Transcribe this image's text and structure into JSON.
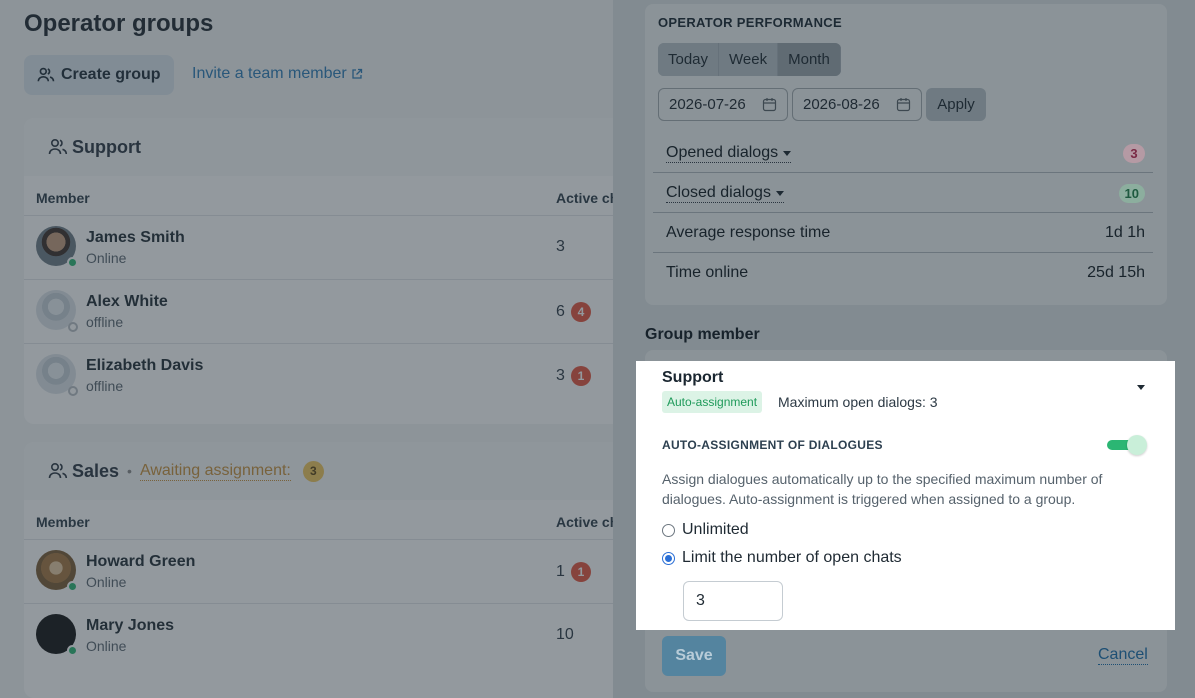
{
  "page": {
    "title": "Operator groups",
    "create_group": "Create group",
    "invite": "Invite a team member"
  },
  "groups": [
    {
      "name": "Support",
      "columns": {
        "member": "Member",
        "active": "Active ch"
      },
      "members": [
        {
          "name": "James Smith",
          "status": "Online",
          "active": "3",
          "badge": ""
        },
        {
          "name": "Alex White",
          "status": "offline",
          "active": "6",
          "badge": "4"
        },
        {
          "name": "Elizabeth Davis",
          "status": "offline",
          "active": "3",
          "badge": "1"
        }
      ]
    },
    {
      "name": "Sales",
      "awaiting_label": "Awaiting assignment:",
      "awaiting_count": "3",
      "columns": {
        "member": "Member",
        "active": "Active ch"
      },
      "members": [
        {
          "name": "Howard Green",
          "status": "Online",
          "active": "1",
          "badge": "1"
        },
        {
          "name": "Mary Jones",
          "status": "Online",
          "active": "10",
          "badge": ""
        }
      ]
    }
  ],
  "panel": {
    "perf_title": "OPERATOR PERFORMANCE",
    "periods": [
      "Today",
      "Week",
      "Month"
    ],
    "active_period": "Month",
    "date_from": "2026-07-26",
    "date_to": "2026-08-26",
    "apply": "Apply",
    "stats": {
      "opened_label": "Opened dialogs",
      "opened_value": "3",
      "closed_label": "Closed dialogs",
      "closed_value": "10",
      "avg_label": "Average response time",
      "avg_value": "1d 1h",
      "online_label": "Time online",
      "online_value": "25d 15h"
    },
    "group_member_title": "Group member",
    "member_card": {
      "group_name": "Support",
      "auto_badge": "Auto-assignment",
      "max_open": "Maximum open dialogs: 3",
      "auto_title": "AUTO-ASSIGNMENT OF DIALOGUES",
      "auto_enabled": true,
      "description": "Assign dialogues automatically up to the specified maximum number of dialogues. Auto-assignment is triggered when assigned to a group.",
      "option_unlimited": "Unlimited",
      "option_limit": "Limit the number of open chats",
      "selected_option": "limit",
      "limit_value": "3"
    },
    "save": "Save",
    "cancel": "Cancel"
  },
  "colors": {
    "online": "#2bb673",
    "badge_red": "#e5533d",
    "link": "#2a7bb6",
    "awaiting": "#c8913a"
  }
}
